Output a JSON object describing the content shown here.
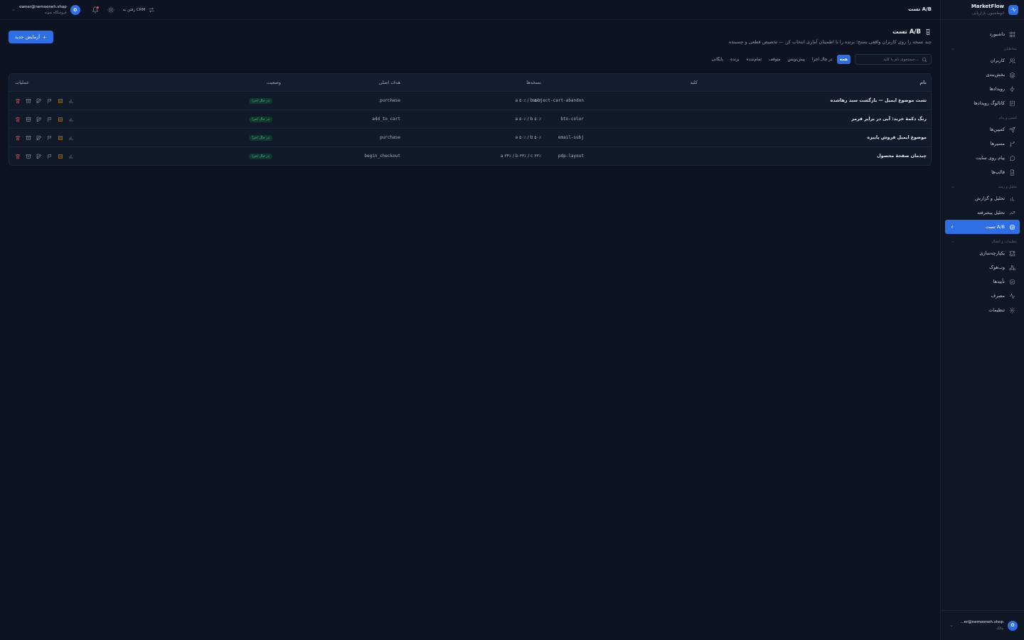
{
  "brand": {
    "name": "MarketFlow",
    "subtitle": "اتوماسیون بازاریابی"
  },
  "sidebar": {
    "top_item": {
      "label": "داشبورد",
      "icon": "dashboard-icon"
    },
    "sections": [
      {
        "title": "مخاطبان",
        "items": [
          {
            "label": "کاربران",
            "icon": "users-icon"
          },
          {
            "label": "بخش‌بندی",
            "icon": "layers-icon"
          },
          {
            "label": "رویدادها",
            "icon": "bolt-icon"
          },
          {
            "label": "کاتالوگ رویدادها",
            "icon": "catalog-icon"
          }
        ]
      },
      {
        "title": "کمپین و پیام",
        "items": [
          {
            "label": "کمپین‌ها",
            "icon": "send-icon"
          },
          {
            "label": "مسیرها",
            "icon": "branch-icon"
          },
          {
            "label": "پیام روی سایت",
            "icon": "message-icon"
          },
          {
            "label": "قالب‌ها",
            "icon": "file-icon"
          }
        ]
      },
      {
        "title": "تحلیل و رشد",
        "items": [
          {
            "label": "تحلیل و گزارش",
            "icon": "bar-chart-icon"
          },
          {
            "label": "تحلیل پیشرفته",
            "icon": "trend-icon"
          },
          {
            "label": "تست A/B",
            "icon": "target-icon",
            "active": true
          }
        ]
      },
      {
        "title": "تنظیمات و اتصال",
        "items": [
          {
            "label": "یکپارچه‌سازی",
            "icon": "puzzle-icon"
          },
          {
            "label": "وب‌هوک",
            "icon": "webhook-icon"
          },
          {
            "label": "تأییدها",
            "icon": "check-circle-icon"
          },
          {
            "label": "مصرف",
            "icon": "activity-icon"
          },
          {
            "label": "تنظیمات",
            "icon": "gear-icon"
          }
        ]
      }
    ],
    "user": {
      "avatar": "O",
      "email": "...er@nemooneh.shop",
      "role": "مالک"
    }
  },
  "topbar": {
    "breadcrumb": "تست A/B",
    "crm_link": "رفتن به CRM",
    "account": {
      "avatar": "O",
      "email": "owner@nemooneh.shop",
      "store": "فروشگاه نمونه"
    }
  },
  "page": {
    "title": "تست A/B",
    "subtitle": "چند نسخه را روی کاربران واقعی بسنج؛ برنده را با اطمینان آماری انتخاب کن — تخصیص قطعی و چسبنده",
    "new_button": "آزمایش جدید",
    "search_placeholder": "جستجوی نام یا کلید...",
    "filters": [
      {
        "label": "همه",
        "active": true
      },
      {
        "label": "در حال اجرا"
      },
      {
        "label": "پیش‌نویس"
      },
      {
        "label": "متوقف"
      },
      {
        "label": "تمام‌شده"
      },
      {
        "label": "برنده"
      },
      {
        "label": "بایگانی"
      }
    ]
  },
  "table": {
    "columns": {
      "name": "نام",
      "key": "کلید",
      "variants": "نسخه‌ها",
      "goal": "هدف اصلی",
      "status": "وضعیت",
      "actions": "عملیات"
    },
    "rows": [
      {
        "name": "تست موضوع ایمیل — بازگشت سبد رهاشده",
        "key": "subject-cart-abandon",
        "variants": "a ۵۰٪ / b ۵۰٪",
        "goal": "purchase",
        "status": "در حال اجرا"
      },
      {
        "name": "رنگ دکمهٔ خرید: آبی در برابر قرمز",
        "key": "btn-color",
        "variants": "a ۵۰٪ / b ۵۰٪",
        "goal": "add_to_cart",
        "status": "در حال اجرا"
      },
      {
        "name": "موضوع ایمیل فروش پاییزه",
        "key": "email-subj",
        "variants": "a ۵۰٪ / b ۵۰٪",
        "goal": "purchase",
        "status": "در حال اجرا"
      },
      {
        "name": "چیدمان صفحهٔ محصول",
        "key": "pdp-layout",
        "variants": "a ۳۴٪ / b ۳۳٪ / c ۳۳٪",
        "goal": "begin_checkout",
        "status": "در حال اجرا"
      }
    ]
  },
  "colors": {
    "accent": "#2f6fe6",
    "running_badge": "#34c28a",
    "stop": "#f59e0b",
    "delete": "#f05252",
    "background": "#0d1320"
  }
}
